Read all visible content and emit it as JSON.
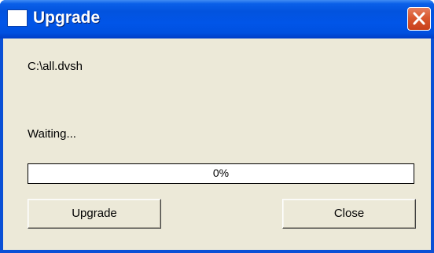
{
  "window": {
    "title": "Upgrade",
    "icon": "window-icon",
    "close_icon": "close-x-icon"
  },
  "file_path": "C:\\all.dvsh",
  "status": "Waiting...",
  "progress": {
    "value": 0,
    "text": "0%"
  },
  "buttons": {
    "upgrade_label": "Upgrade",
    "close_label": "Close"
  },
  "colors": {
    "titlebar": "#0253de",
    "client_bg": "#ece9d8",
    "close_button": "#d9582f",
    "progress_fill": "#2f64d8"
  }
}
